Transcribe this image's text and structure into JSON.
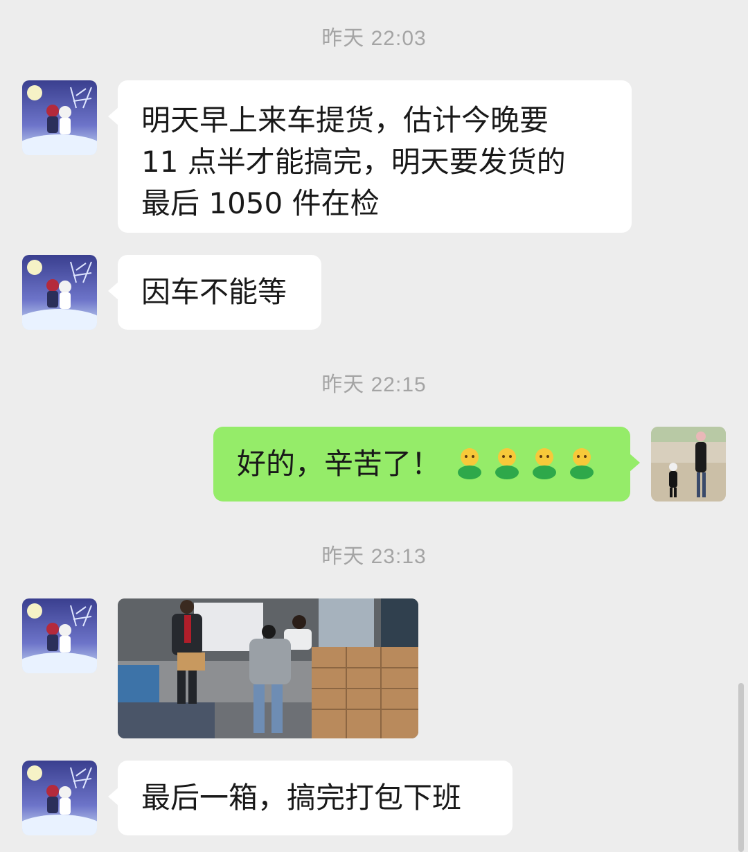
{
  "timestamps": [
    "昨天 22:03",
    "昨天 22:15",
    "昨天 23:13"
  ],
  "messages": {
    "m1": {
      "sender": "contact",
      "lines": [
        "明天早上来车提货，估计今晚要",
        "11 点半才能搞完，明天要发货的",
        "最后 1050 件在检"
      ]
    },
    "m2": {
      "sender": "contact",
      "text": "因车不能等"
    },
    "m3": {
      "sender": "me",
      "text": "好的，辛苦了！",
      "emoji": [
        "smile-emoji",
        "smile-emoji",
        "smile-emoji",
        "smile-emoji"
      ]
    },
    "m4": {
      "sender": "contact",
      "type": "image"
    },
    "m5": {
      "sender": "contact",
      "text": "最后一箱，搞完打包下班"
    }
  },
  "colors": {
    "background": "#ededed",
    "incoming_bubble": "#ffffff",
    "outgoing_bubble": "#95ec69",
    "timestamp": "#a4a4a4"
  }
}
